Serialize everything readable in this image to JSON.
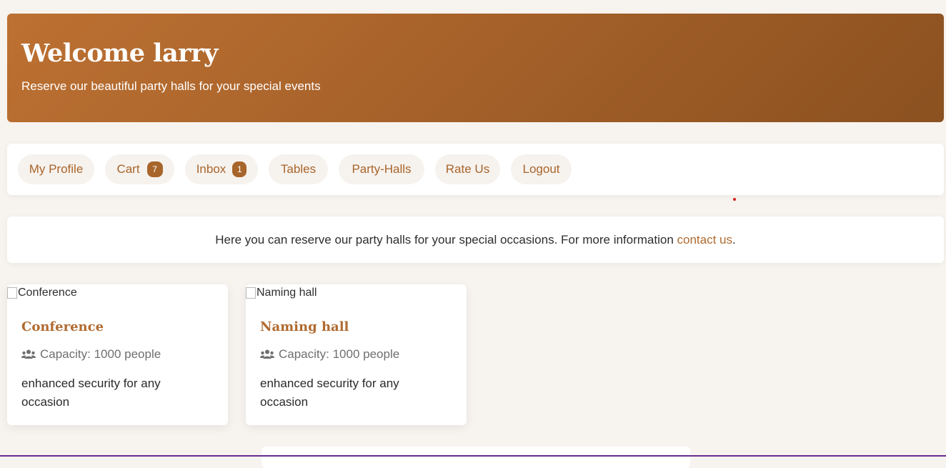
{
  "header": {
    "title": "Welcome larry",
    "subtitle": "Reserve our beautiful party halls for your special events"
  },
  "nav": {
    "items": [
      {
        "label": "My Profile"
      },
      {
        "label": "Cart",
        "badge": "7"
      },
      {
        "label": "Inbox",
        "badge": "1"
      },
      {
        "label": "Tables"
      },
      {
        "label": "Party-Halls"
      },
      {
        "label": "Rate Us"
      },
      {
        "label": "Logout"
      }
    ]
  },
  "info": {
    "text": "Here you can reserve our party halls for your special occasions. For more information ",
    "link": "contact us",
    "suffix": "."
  },
  "halls": [
    {
      "image_alt": "Conference",
      "title": "Conference",
      "capacity": "Capacity: 1000 people",
      "description": "enhanced security for any occasion"
    },
    {
      "image_alt": "Naming hall",
      "title": "Naming hall",
      "capacity": "Capacity: 1000 people",
      "description": "enhanced security for any occasion"
    }
  ],
  "icons": {
    "capacity": "users-icon",
    "broken_image": "broken-image-icon"
  },
  "colors": {
    "accent": "#a8652b",
    "hero_start": "#bd7132",
    "hero_end": "#8b5120",
    "background": "#f7f3ef"
  }
}
